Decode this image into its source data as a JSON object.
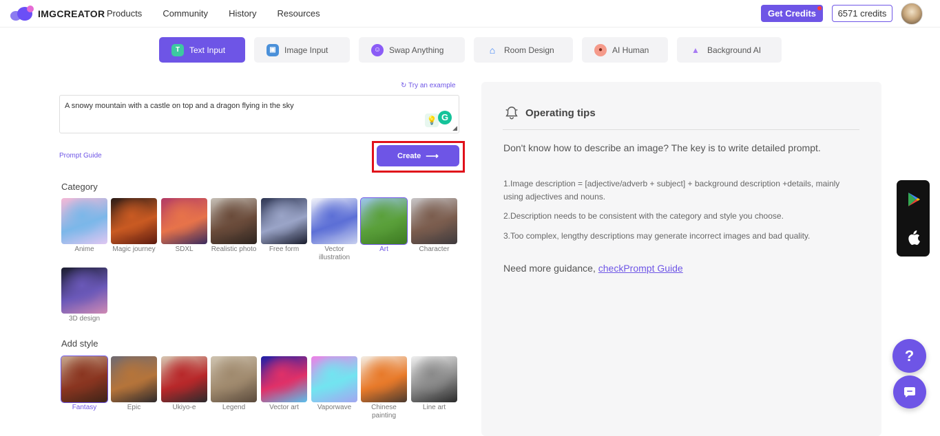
{
  "header": {
    "logo_text": "IMGCREATOR",
    "nav": [
      "Products",
      "Community",
      "History",
      "Resources"
    ],
    "get_credits": "Get Credits",
    "credits": "6571 credits"
  },
  "tabs": [
    {
      "label": "Text Input",
      "icon": "text-icon",
      "active": true
    },
    {
      "label": "Image Input",
      "icon": "image-icon"
    },
    {
      "label": "Swap Anything",
      "icon": "swap-icon"
    },
    {
      "label": "Room Design",
      "icon": "house-icon"
    },
    {
      "label": "AI Human",
      "icon": "human-icon"
    },
    {
      "label": "Background AI",
      "icon": "background-icon"
    }
  ],
  "prompt": {
    "try_example": "Try an example",
    "value": "A snowy mountain with a castle on top and a dragon flying in the sky",
    "guide": "Prompt Guide",
    "create": "Create"
  },
  "category": {
    "title": "Category",
    "items": [
      {
        "label": "Anime",
        "colors": [
          "#f6b8d6",
          "#7bb7e9",
          "#e0c7f2"
        ]
      },
      {
        "label": "Magic journey",
        "colors": [
          "#2a1b17",
          "#c95a22",
          "#5d1b10"
        ]
      },
      {
        "label": "SDXL",
        "colors": [
          "#b23b66",
          "#e7734a",
          "#3a2b5e"
        ]
      },
      {
        "label": "Realistic photo",
        "colors": [
          "#c7c1b8",
          "#6a4b3a",
          "#2e2520"
        ]
      },
      {
        "label": "Free form",
        "colors": [
          "#2d3552",
          "#9aa4c7",
          "#1a1d2e"
        ]
      },
      {
        "label": "Vector illustration",
        "colors": [
          "#f4f5fa",
          "#5c6fd6",
          "#c8d0ef"
        ]
      },
      {
        "label": "Art",
        "colors": [
          "#9ec6ef",
          "#5aa03a",
          "#3d7a22"
        ],
        "selected": true
      },
      {
        "label": "Character",
        "colors": [
          "#c9c7c9",
          "#7b5d4e",
          "#3e3a3d"
        ]
      },
      {
        "label": "3D design",
        "colors": [
          "#1a1c2e",
          "#6a58b8",
          "#d08ab4"
        ]
      }
    ]
  },
  "style": {
    "title": "Add style",
    "items": [
      {
        "label": "Fantasy",
        "colors": [
          "#c7a88e",
          "#8a3520",
          "#3e2418"
        ],
        "selected": true
      },
      {
        "label": "Epic",
        "colors": [
          "#6f6a72",
          "#b5743a",
          "#2f2a2c"
        ]
      },
      {
        "label": "Ukiyo-e",
        "colors": [
          "#d7c9b4",
          "#b8282a",
          "#2c2a2c"
        ]
      },
      {
        "label": "Legend",
        "colors": [
          "#cfc4b1",
          "#a08a6e",
          "#5a4a3c"
        ]
      },
      {
        "label": "Vector art",
        "colors": [
          "#1c1fa8",
          "#e03068",
          "#5ac0ec"
        ]
      },
      {
        "label": "Vaporwave",
        "colors": [
          "#ee7fe6",
          "#72e4f0",
          "#a2a6f0"
        ]
      },
      {
        "label": "Chinese painting",
        "colors": [
          "#f4efe6",
          "#e87a2a",
          "#4c3a2e"
        ]
      },
      {
        "label": "Line art",
        "colors": [
          "#f0f0f0",
          "#8a8a8a",
          "#2a2a2a"
        ]
      }
    ]
  },
  "tips": {
    "title": "Operating tips",
    "lead": "Don't know how to describe an image? The key is to write detailed prompt.",
    "items": [
      "1.Image description = [adjective/adverb + subject] + background description +details, mainly using adjectives and nouns.",
      "2.Description needs to be consistent with the category and style you choose.",
      "3.Too complex, lengthy descriptions may generate incorrect images and bad quality."
    ],
    "more_prefix": "Need more guidance, ",
    "more_link": "checkPrompt Guide"
  },
  "floating": {
    "help": "?"
  },
  "theme": {
    "accent": "#6e55e6",
    "highlight": "#e0101a"
  }
}
